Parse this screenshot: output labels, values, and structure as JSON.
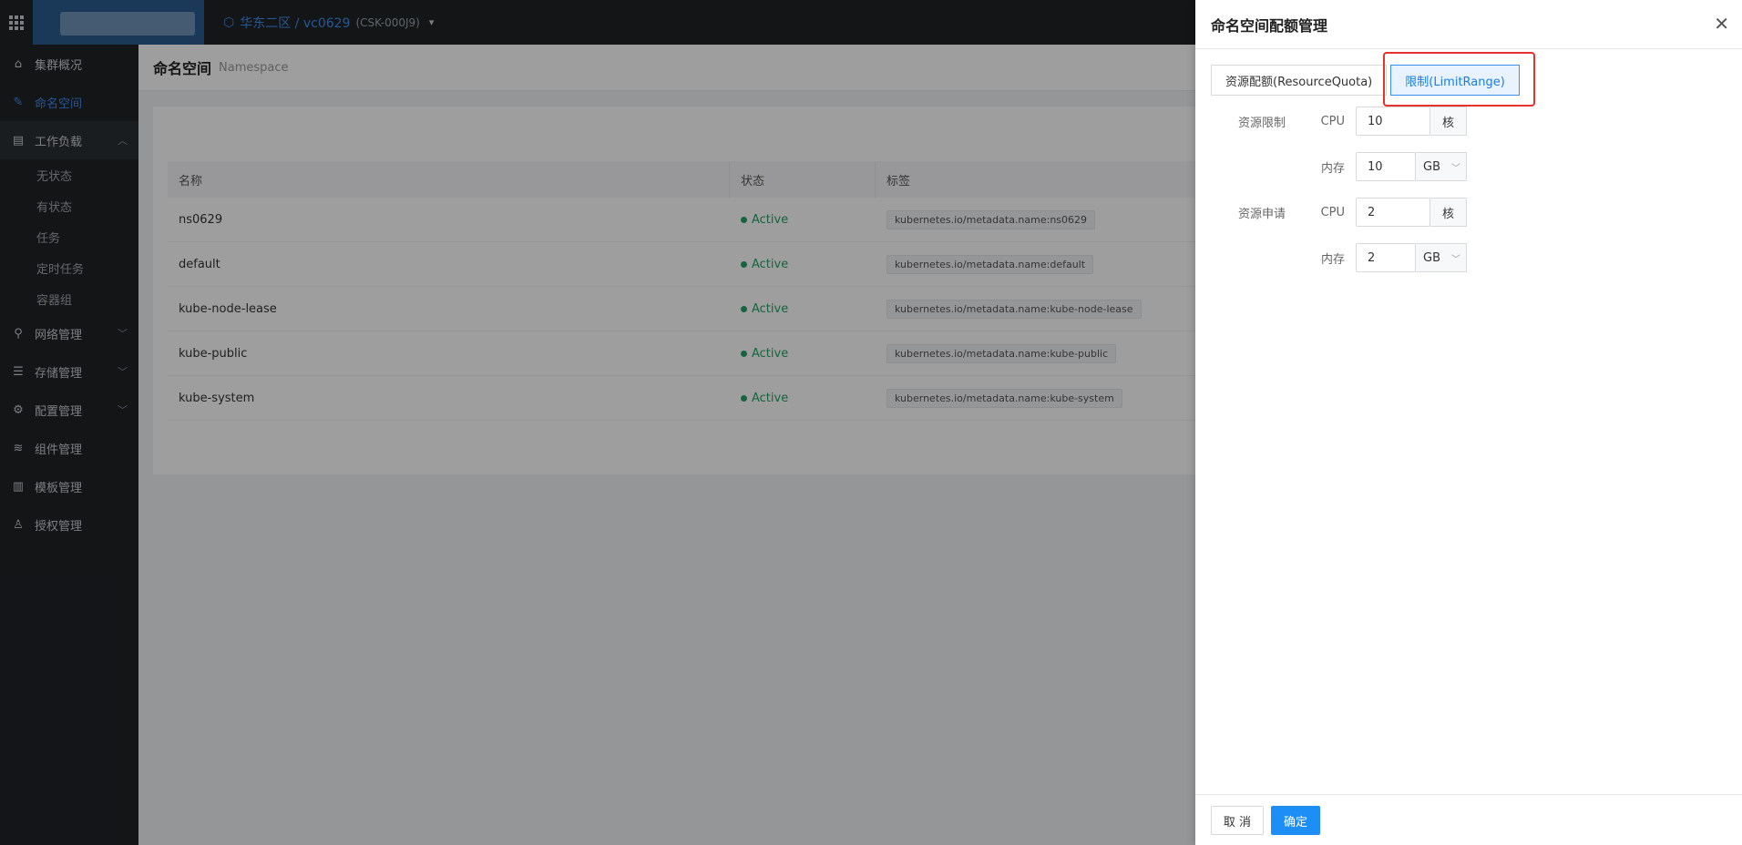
{
  "topbar": {
    "region_label": "华东二区 / vc0629",
    "cluster_code": "(CSK-000J9)"
  },
  "sidebar": {
    "items": [
      {
        "label": "集群概况",
        "icon": "home-icon"
      },
      {
        "label": "命名空间",
        "icon": "edit-square-icon"
      },
      {
        "label": "工作负载",
        "icon": "workload-icon"
      },
      {
        "label": "网络管理",
        "icon": "network-icon"
      },
      {
        "label": "存储管理",
        "icon": "storage-icon"
      },
      {
        "label": "配置管理",
        "icon": "config-icon"
      },
      {
        "label": "组件管理",
        "icon": "layers-icon"
      },
      {
        "label": "模板管理",
        "icon": "template-icon"
      },
      {
        "label": "授权管理",
        "icon": "user-auth-icon"
      }
    ],
    "sub_items": [
      "无状态",
      "有状态",
      "任务",
      "定时任务",
      "容器组"
    ]
  },
  "page": {
    "title": "命名空间",
    "subtitle": "Namespace"
  },
  "table": {
    "headers": [
      "名称",
      "状态",
      "标签"
    ],
    "rows": [
      {
        "name": "ns0629",
        "status": "Active",
        "label": "kubernetes.io/metadata.name:ns0629"
      },
      {
        "name": "default",
        "status": "Active",
        "label": "kubernetes.io/metadata.name:default"
      },
      {
        "name": "kube-node-lease",
        "status": "Active",
        "label": "kubernetes.io/metadata.name:kube-node-lease"
      },
      {
        "name": "kube-public",
        "status": "Active",
        "label": "kubernetes.io/metadata.name:kube-public"
      },
      {
        "name": "kube-system",
        "status": "Active",
        "label": "kubernetes.io/metadata.name:kube-system"
      }
    ]
  },
  "drawer": {
    "title": "命名空间配额管理",
    "tabs": [
      "资源配额(ResourceQuota)",
      "限制(LimitRange)"
    ],
    "active_tab": "限制(LimitRange)",
    "limit": {
      "group_label": "资源限制",
      "cpu_label": "CPU",
      "cpu_value": "10",
      "cpu_unit": "核",
      "mem_label": "内存",
      "mem_value": "10",
      "mem_unit": "GB"
    },
    "request": {
      "group_label": "资源申请",
      "cpu_label": "CPU",
      "cpu_value": "2",
      "cpu_unit": "核",
      "mem_label": "内存",
      "mem_value": "2",
      "mem_unit": "GB"
    },
    "cancel_label": "取 消",
    "ok_label": "确定"
  },
  "colors": {
    "accent": "#1d8ef5",
    "status_active": "#21a366",
    "highlight_box": "#e5322d"
  }
}
